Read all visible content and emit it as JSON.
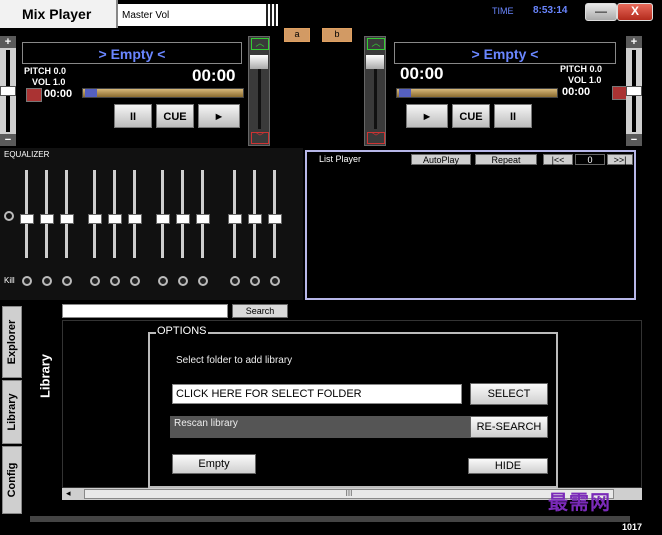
{
  "app": {
    "title": "Mix Player",
    "master_vol_label": "Master Vol"
  },
  "clock": {
    "label": "TIME",
    "value": "8:53:14"
  },
  "window_controls": {
    "minimize": "—",
    "close": "X"
  },
  "cue_points": {
    "a": "a",
    "b": "b"
  },
  "deck_left": {
    "title": "> Empty <",
    "pitch": "PITCH 0.0",
    "vol": "VOL 1.0",
    "time_small": "00:00",
    "time_big": "00:00",
    "buttons": {
      "pause": "II",
      "cue": "CUE",
      "play": "►"
    }
  },
  "deck_right": {
    "title": "> Empty <",
    "pitch": "PITCH 0.0",
    "vol": "VOL 1.0",
    "time_small": "00:00",
    "time_big": "00:00",
    "buttons": {
      "play": "►",
      "cue": "CUE",
      "pause": "II"
    }
  },
  "side_buttons": {
    "plus": "+",
    "minus": "−"
  },
  "equalizer": {
    "label": "EQUALIZER",
    "kill_label": "Kill"
  },
  "list_player": {
    "title": "List Player",
    "autoplay": "AutoPlay",
    "repeat": "Repeat",
    "prev": "|<<",
    "count": "0",
    "next": ">>|"
  },
  "side_tabs": {
    "explorer": "Explorer",
    "library": "Library",
    "config": "Config"
  },
  "library": {
    "title": "Library",
    "search_value": "",
    "search_button": "Search"
  },
  "options": {
    "legend": "OPTIONS",
    "select_folder_text": "Select folder to add library",
    "folder_field": "CLICK HERE FOR SELECT FOLDER",
    "select_button": "SELECT",
    "rescan_text": "Rescan library",
    "research_button": "RE-SEARCH",
    "empty_button": "Empty",
    "hide_button": "HIDE"
  },
  "scrollbar": {
    "grip": "III"
  },
  "footer": {
    "version": "1017",
    "watermark": "最需网"
  }
}
